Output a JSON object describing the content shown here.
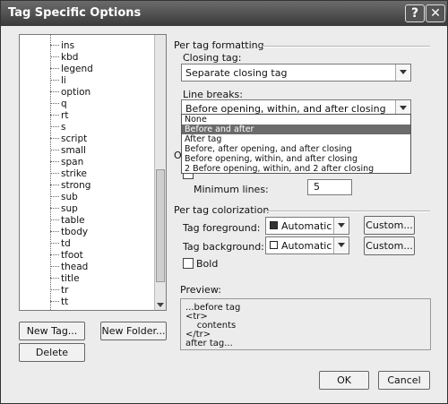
{
  "window": {
    "title": "Tag Specific Options",
    "help_glyph": "?",
    "close_glyph": "✕"
  },
  "tags": [
    "ins",
    "kbd",
    "legend",
    "li",
    "option",
    "q",
    "rt",
    "s",
    "script",
    "small",
    "span",
    "strike",
    "strong",
    "sub",
    "sup",
    "table",
    "tbody",
    "td",
    "tfoot",
    "thead",
    "title",
    "tr",
    "tt"
  ],
  "buttons": {
    "new_tag": "New Tag...",
    "new_folder": "New Folder...",
    "delete": "Delete",
    "ok": "OK",
    "cancel": "Cancel",
    "custom_fg": "Custom...",
    "custom_bg": "Custom..."
  },
  "formatting": {
    "heading": "Per tag formatting",
    "closing_tag_label": "Closing tag:",
    "closing_tag_value": "Separate closing tag",
    "line_breaks_label": "Line breaks:",
    "line_breaks_value": "Before opening, within, and after closing",
    "line_break_options": [
      "None",
      "Before and after",
      "After tag",
      "Before, after opening, and after closing",
      "Before opening, within, and after closing",
      "2 Before opening, within, and 2 after closing"
    ],
    "selected_option_index": 1,
    "partial_heading": "Ou",
    "minimum_lines_label": "Minimum lines:",
    "minimum_lines_value": "5"
  },
  "colorization": {
    "heading": "Per tag colorization",
    "fg_label": "Tag foreground:",
    "fg_value": "Automatic",
    "fg_swatch": "#333333",
    "bg_label": "Tag background:",
    "bg_value": "Automatic",
    "bg_swatch": "#ffffff",
    "bold_label": "Bold"
  },
  "preview": {
    "label": "Preview:",
    "lines": [
      "...before tag",
      "<tr>",
      "    contents",
      "</tr>",
      "after tag..."
    ]
  }
}
